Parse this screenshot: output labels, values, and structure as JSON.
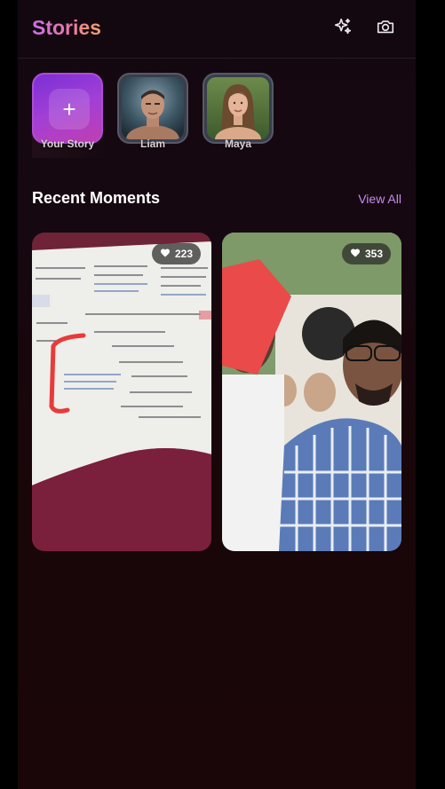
{
  "header": {
    "title": "Stories",
    "effects_icon": "sparkles-icon",
    "camera_icon": "camera-icon"
  },
  "stories": [
    {
      "label": "Your Story",
      "type": "own",
      "icon": "plus-icon"
    },
    {
      "label": "Liam",
      "type": "user",
      "image": "man-portrait"
    },
    {
      "label": "Maya",
      "type": "user",
      "image": "woman-portrait"
    }
  ],
  "recent": {
    "title": "Recent Moments",
    "view_all": "View All"
  },
  "moments": [
    {
      "likes": "223",
      "image": "handwritten-prescription-note"
    },
    {
      "likes": "353",
      "image": "two-people-selfie-outdoor"
    }
  ],
  "colors": {
    "accent": "#c58cf0",
    "title_gradient_start": "#c970e8",
    "title_gradient_end": "#f3a36a",
    "background": "#160810"
  }
}
